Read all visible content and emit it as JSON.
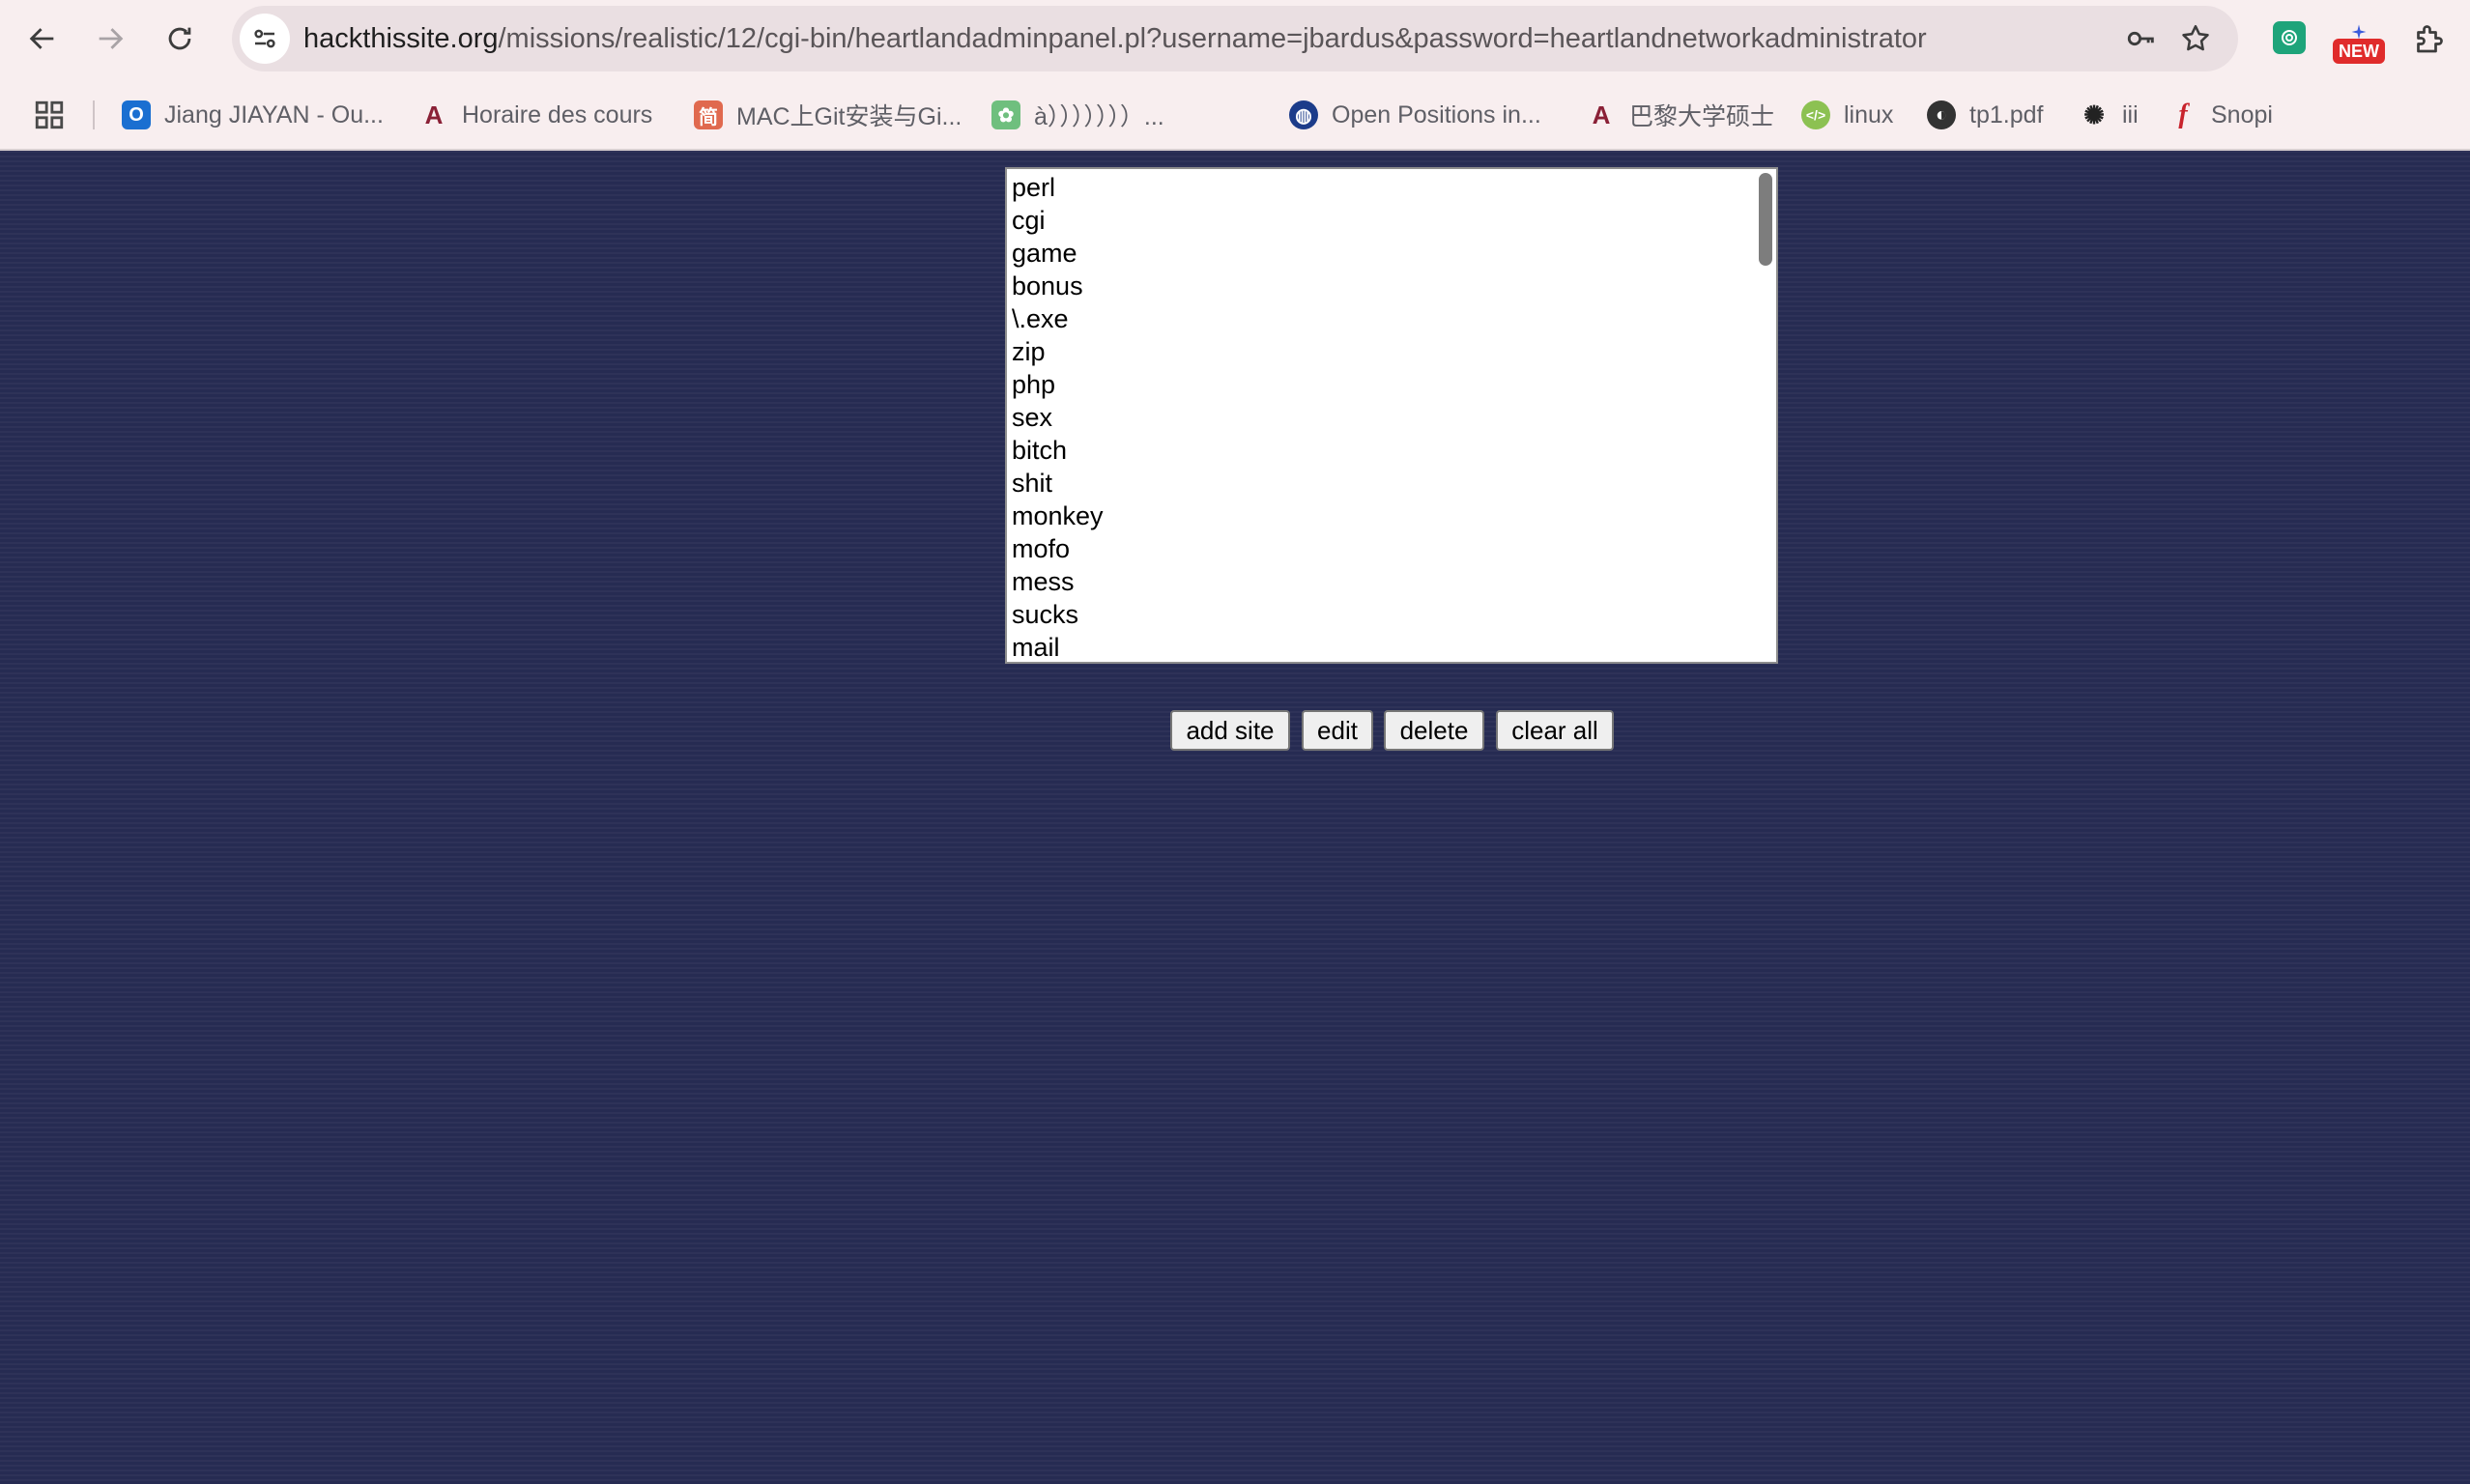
{
  "browser": {
    "url_host": "hackthissite.org",
    "url_path": "/missions/realistic/12/cgi-bin/heartlandadminpanel.pl?username=jbardus&password=heartlandnetworkadministrator",
    "extension_new_badge": "NEW",
    "bookmarks": [
      {
        "label": "Jiang JIAYAN - Ou...",
        "icon": "outlook-icon",
        "color": "#1a6fd1"
      },
      {
        "label": "Horaire des cours",
        "icon": "university-logo-icon",
        "color": "#8a2036"
      },
      {
        "label": "MAC上Git安装与Gi...",
        "icon": "jianshu-icon",
        "color": "#e0694e"
      },
      {
        "label": "à）））））））...",
        "icon": "paw-icon",
        "color": "#6fbf7e"
      },
      {
        "label": "Open Positions in...",
        "icon": "globe-icon",
        "color": "#1c3c8a"
      },
      {
        "label": "巴黎大学硕士",
        "icon": "university-logo-icon",
        "color": "#8a2036"
      },
      {
        "label": "linux",
        "icon": "code-icon",
        "color": "#8cc152"
      },
      {
        "label": "tp1.pdf",
        "icon": "world-icon",
        "color": "#333333"
      },
      {
        "label": "iii",
        "icon": "openai-icon",
        "color": "#222222"
      },
      {
        "label": "Snopi",
        "icon": "flash-icon",
        "color": "#c8232c"
      }
    ]
  },
  "sites_list": {
    "items": [
      "perl",
      "cgi",
      "game",
      "bonus",
      "\\.exe",
      "zip",
      "php",
      "sex",
      "bitch",
      "shit",
      "monkey",
      "mofo",
      "mess",
      "sucks",
      "mail"
    ]
  },
  "actions": {
    "add_site": "add site",
    "edit": "edit",
    "delete": "delete",
    "clear_all": "clear all"
  },
  "colors": {
    "page_background": "#262b52",
    "chrome_background": "#f8eeef"
  }
}
